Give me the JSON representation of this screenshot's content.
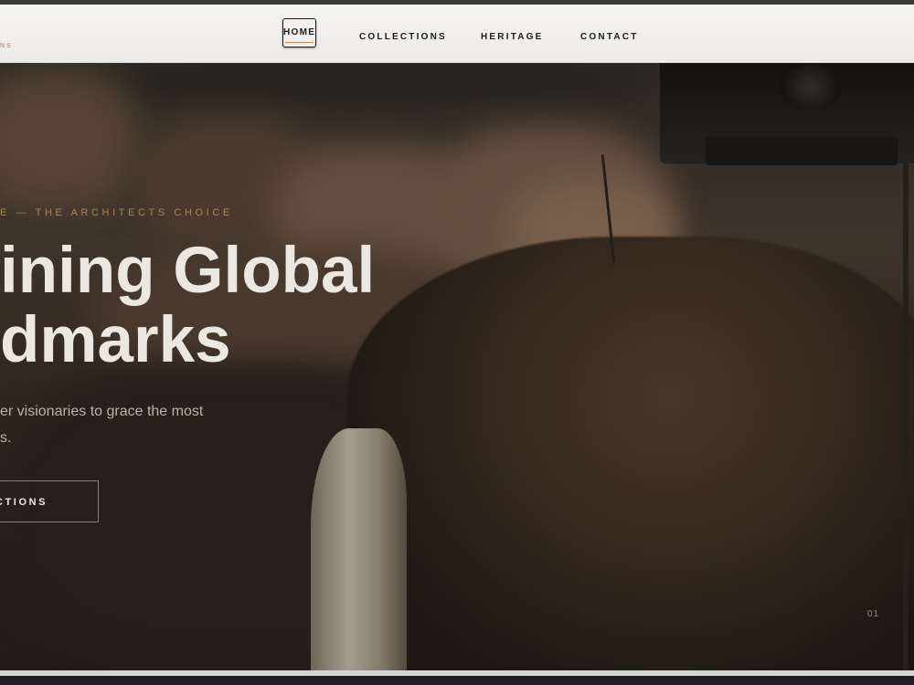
{
  "header": {
    "logo_sub": "NS",
    "nav": [
      {
        "label": "HOME"
      },
      {
        "label": "COLLECTIONS"
      },
      {
        "label": "HERITAGE"
      },
      {
        "label": "CONTACT"
      }
    ]
  },
  "hero": {
    "eyebrow": "E — THE ARCHITECTS CHOICE",
    "headline_lines": [
      "ining Global",
      "dmarks"
    ],
    "subtitle_lines": [
      "er visionaries to grace the most",
      "s."
    ],
    "cta_label": "ECTIONS",
    "slide_number": "01"
  },
  "colors": {
    "accent": "#c98a4b",
    "eyebrow": "#a98656",
    "header_bg": "#f3f1ee",
    "headline": "#ece7e1"
  }
}
